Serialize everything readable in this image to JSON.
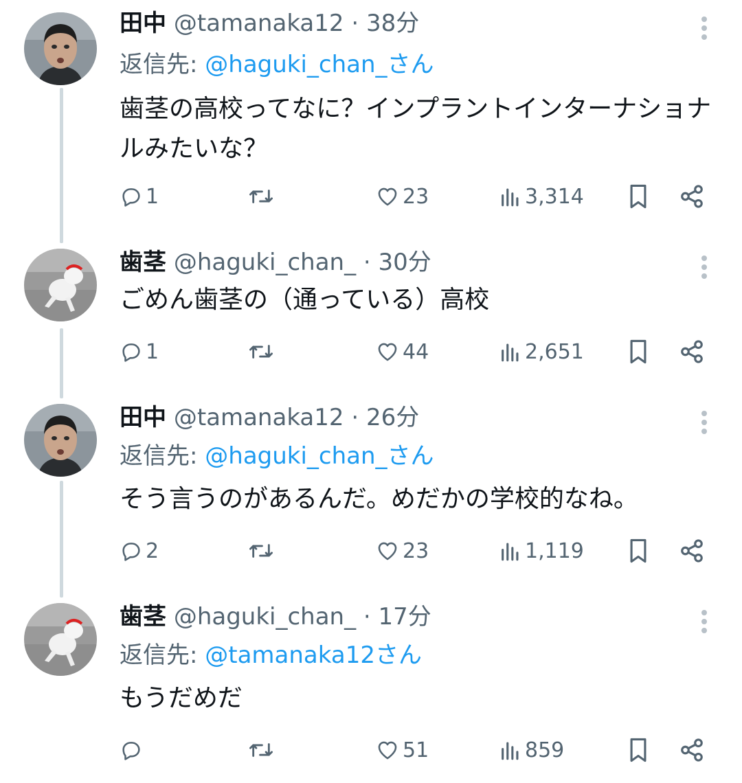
{
  "tweets": [
    {
      "name": "田中",
      "handle": "@tamanaka12",
      "time": "· 38分",
      "reply_prefix": "返信先: ",
      "reply_to": "@haguki_chan_さん",
      "text": "歯茎の高校ってなに？インプラントインターナショナルみたいな？",
      "replies": "1",
      "retweets": "",
      "likes": "23",
      "views": "3,314",
      "avatar": "man-photo"
    },
    {
      "name": "歯茎",
      "handle": "@haguki_chan_",
      "time": "· 30分",
      "reply_prefix": "",
      "reply_to": "",
      "text": "ごめん歯茎の（通っている）高校",
      "replies": "1",
      "retweets": "",
      "likes": "44",
      "views": "2,651",
      "avatar": "cat-photo"
    },
    {
      "name": "田中",
      "handle": "@tamanaka12",
      "time": "· 26分",
      "reply_prefix": "返信先: ",
      "reply_to": "@haguki_chan_さん",
      "text": "そう言うのがあるんだ。めだかの学校的なね。",
      "replies": "2",
      "retweets": "",
      "likes": "23",
      "views": "1,119",
      "avatar": "man-photo"
    },
    {
      "name": "歯茎",
      "handle": "@haguki_chan_",
      "time": "· 17分",
      "reply_prefix": "返信先: ",
      "reply_to": "@tamanaka12さん",
      "text": "もうだめだ",
      "replies": "",
      "retweets": "",
      "likes": "51",
      "views": "859",
      "avatar": "cat-photo"
    }
  ],
  "colors": {
    "link": "#1d9bf0",
    "muted": "#536471",
    "text": "#0f1419",
    "thread_line": "#cfd9de"
  }
}
